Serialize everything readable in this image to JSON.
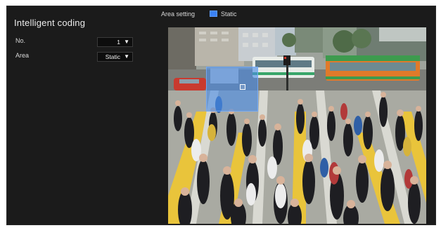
{
  "panel": {
    "title": "Intelligent coding",
    "fields": {
      "no_label": "No.",
      "no_value": "1",
      "area_label": "Area",
      "area_value": "Static"
    }
  },
  "area_setting": {
    "label": "Area setting",
    "legend_name": "Static",
    "legend_color": "#3b82f6"
  },
  "icons": {
    "dropdown": "chevron-down-icon",
    "handle": "area-handle-icon"
  }
}
